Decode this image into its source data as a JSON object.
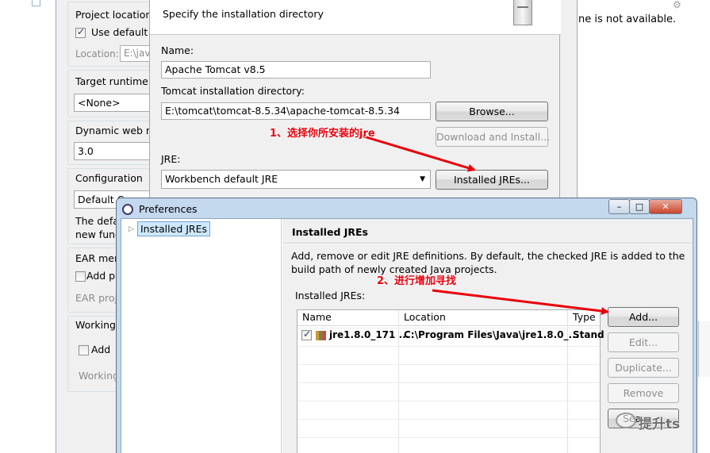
{
  "background_error": "ne is not available.",
  "wizard": {
    "project_location_label": "Project location",
    "use_default_label": "Use default",
    "location_label": "Location:",
    "location_value": "E:\\jav",
    "target_runtime_label": "Target runtime",
    "target_runtime_value": "<None>",
    "dynamic_web_label": "Dynamic web m",
    "dynamic_web_value": "3.0",
    "configuration_label": "Configuration",
    "configuration_value": "Default C",
    "config_desc_line1": "The defa",
    "config_desc_line2": "new func",
    "ear_label": "EAR mem",
    "ear_add_label": "Add p",
    "ear_project_label": "EAR proj",
    "working_label": "Working",
    "working_add_label": "Add",
    "working_sets_label": "Working"
  },
  "runtime_dialog": {
    "header_text": "Specify the installation directory",
    "name_label": "Name:",
    "name_value": "Apache Tomcat v8.5",
    "dir_label": "Tomcat installation directory:",
    "dir_value": "E:\\tomcat\\tomcat-8.5.34\\apache-tomcat-8.5.34",
    "browse_label": "Browse...",
    "download_label": "Download and Install...",
    "jre_label": "JRE:",
    "jre_value": "Workbench default JRE",
    "installed_jres_label": "Installed JREs..."
  },
  "preferences": {
    "title": "Preferences",
    "tree_item": "Installed JREs",
    "page_title": "Installed JREs",
    "desc_line1": "Add, remove or edit JRE definitions. By default, the checked JRE is added to the",
    "desc_line2": "build path of newly created Java projects.",
    "list_label": "Installed JREs:",
    "columns": [
      "Name",
      "Location",
      "Type"
    ],
    "rows": [
      {
        "checked": true,
        "name": "jre1.8.0_171 ...",
        "location": "C:\\Program Files\\Java\\jre1.8.0_...",
        "type": "Stand"
      }
    ],
    "buttons": {
      "add": "Add...",
      "edit": "Edit...",
      "duplicate": "Duplicate...",
      "remove": "Remove",
      "search": "Sea"
    }
  },
  "annotations": {
    "step1": "1、选择你所安装的jre",
    "step2": "2、进行增加寻找"
  },
  "watermark": "提升ts",
  "colors": {
    "annotation": "#e8000b",
    "selection": "#cde8ff"
  }
}
